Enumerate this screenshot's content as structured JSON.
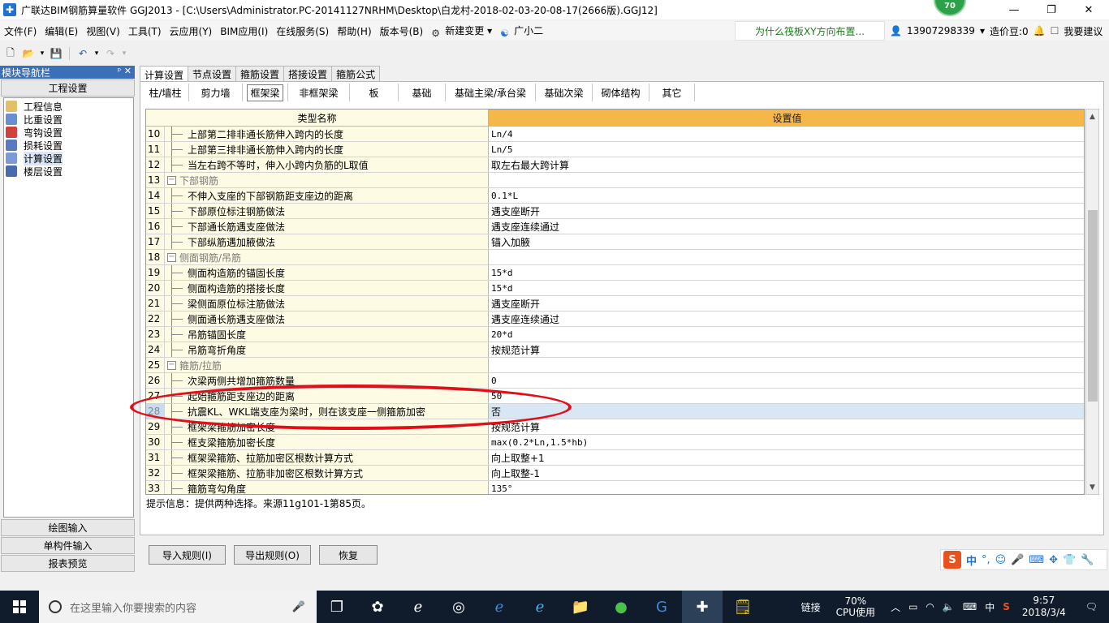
{
  "window": {
    "title": "广联达BIM钢筋算量软件 GGJ2013 - [C:\\Users\\Administrator.PC-20141127NRHM\\Desktop\\白龙村-2018-02-03-20-08-17(2666版).GGJ12]",
    "badge": "70"
  },
  "menu": {
    "items": [
      "文件(F)",
      "编辑(E)",
      "视图(V)",
      "工具(T)",
      "云应用(Y)",
      "BIM应用(I)",
      "在线服务(S)",
      "帮助(H)",
      "版本号(B)"
    ],
    "new_change": "新建变更",
    "assistant": "广小二",
    "hint": "为什么筏板XY方向布置...",
    "phone": "13907298339",
    "coins": "造价豆:0",
    "suggest": "我要建议"
  },
  "nav": {
    "header": "模块导航栏",
    "section": "工程设置",
    "items": [
      "工程信息",
      "比重设置",
      "弯钩设置",
      "损耗设置",
      "计算设置",
      "楼层设置"
    ],
    "selected": "计算设置",
    "bottom_buttons": [
      "绘图输入",
      "单构件输入",
      "报表预览"
    ]
  },
  "main": {
    "tabs": [
      "计算设置",
      "节点设置",
      "箍筋设置",
      "搭接设置",
      "箍筋公式"
    ],
    "active_tab": "计算设置",
    "subtabs": [
      "柱/墙柱",
      "剪力墙",
      "框架梁",
      "非框架梁",
      "板",
      "基础",
      "基础主梁/承台梁",
      "基础次梁",
      "砌体结构",
      "其它"
    ],
    "active_subtab": "框架梁",
    "columns": [
      "类型名称",
      "设置值"
    ],
    "rows": [
      {
        "num": "10",
        "name": "上部第二排非通长筋伸入跨内的长度",
        "value": "Ln/4",
        "group": false
      },
      {
        "num": "11",
        "name": "上部第三排非通长筋伸入跨内的长度",
        "value": "Ln/5",
        "group": false
      },
      {
        "num": "12",
        "name": "当左右跨不等时，伸入小跨内负筋的L取值",
        "value": "取左右最大跨计算",
        "group": false
      },
      {
        "num": "13",
        "name": "下部钢筋",
        "value": "",
        "group": true
      },
      {
        "num": "14",
        "name": "不伸入支座的下部钢筋距支座边的距离",
        "value": "0.1*L",
        "group": false
      },
      {
        "num": "15",
        "name": "下部原位标注钢筋做法",
        "value": "遇支座断开",
        "group": false
      },
      {
        "num": "16",
        "name": "下部通长筋遇支座做法",
        "value": "遇支座连续通过",
        "group": false
      },
      {
        "num": "17",
        "name": "下部纵筋遇加腋做法",
        "value": "锚入加腋",
        "group": false
      },
      {
        "num": "18",
        "name": "侧面钢筋/吊筋",
        "value": "",
        "group": true
      },
      {
        "num": "19",
        "name": "侧面构造筋的锚固长度",
        "value": "15*d",
        "group": false
      },
      {
        "num": "20",
        "name": "侧面构造筋的搭接长度",
        "value": "15*d",
        "group": false
      },
      {
        "num": "21",
        "name": "梁侧面原位标注筋做法",
        "value": "遇支座断开",
        "group": false
      },
      {
        "num": "22",
        "name": "侧面通长筋遇支座做法",
        "value": "遇支座连续通过",
        "group": false
      },
      {
        "num": "23",
        "name": "吊筋锚固长度",
        "value": "20*d",
        "group": false
      },
      {
        "num": "24",
        "name": "吊筋弯折角度",
        "value": "按规范计算",
        "group": false
      },
      {
        "num": "25",
        "name": "箍筋/拉筋",
        "value": "",
        "group": true
      },
      {
        "num": "26",
        "name": "次梁两侧共增加箍筋数量",
        "value": "0",
        "group": false
      },
      {
        "num": "27",
        "name": "起始箍筋距支座边的距离",
        "value": "50",
        "group": false
      },
      {
        "num": "28",
        "name": "抗震KL、WKL端支座为梁时，则在该支座一侧箍筋加密",
        "value": "否",
        "group": false,
        "selected": true
      },
      {
        "num": "29",
        "name": "框架梁箍筋加密长度",
        "value": "按规范计算",
        "group": false
      },
      {
        "num": "30",
        "name": "框支梁箍筋加密长度",
        "value": "max(0.2*Ln,1.5*hb)",
        "group": false
      },
      {
        "num": "31",
        "name": "框架梁箍筋、拉筋加密区根数计算方式",
        "value": "向上取整+1",
        "group": false
      },
      {
        "num": "32",
        "name": "框架梁箍筋、拉筋非加密区根数计算方式",
        "value": "向上取整-1",
        "group": false
      },
      {
        "num": "33",
        "name": "箍筋弯勾角度",
        "value": "135°",
        "group": false
      }
    ],
    "tip": "提示信息：提供两种选择。来源11g101-1第85页。",
    "buttons": [
      "导入规则(I)",
      "导出规则(O)",
      "恢复"
    ]
  },
  "taskbar": {
    "search_placeholder": "在这里输入你要搜索的内容",
    "link": "链接",
    "cpu_percent": "70%",
    "cpu_label": "CPU使用",
    "ime": "中",
    "time": "9:57",
    "date": "2018/3/4"
  },
  "colors": {
    "header_orange": "#f5b74a",
    "row_yellow": "#fdfbe3",
    "nav_blue": "#3b6fb6",
    "annotation_red": "#e0101a",
    "taskbar": "#101c2c"
  }
}
